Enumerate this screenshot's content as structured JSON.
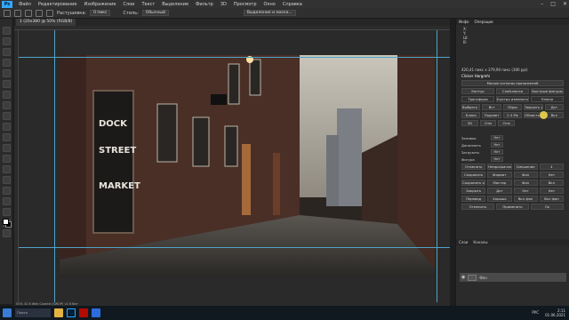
{
  "app": {
    "logo": "Ps"
  },
  "menu": [
    "Файл",
    "Редактирование",
    "Изображение",
    "Слои",
    "Текст",
    "Выделение",
    "Фильтр",
    "3D",
    "Просмотр",
    "Окно",
    "Справка"
  ],
  "options_bar": {
    "label1": "Растушевка:",
    "feather_value": "0 пикс",
    "label2": "Стиль:",
    "style_value": "Обычный",
    "label3": "Выделение и маска..."
  },
  "document_tab": "1 (20x380 @ 50% (RGB/8)",
  "status": "50%     32.6 Web Coated (SWOP) v2 8 бит",
  "panel": {
    "tabs": [
      "Инфо",
      "Операции"
    ],
    "info_lines": [
      "X:",
      "Y:",
      "Ш:",
      "В:"
    ],
    "doc_size": "420,41 пикс x 379,90 пикс (300 ppi)",
    "header": "Clicker Hargrehi",
    "section_title": "Малые сигналы приложений",
    "btns_row1": [
      "Контур",
      "Слой-маска",
      "Быстрые фигуры"
    ],
    "btns_row2": [
      "Трансформ",
      "Быстро изменить",
      "Ключи"
    ],
    "btns_row3": [
      "Выбрать точку...",
      "Вст",
      "Сброс",
      "Закрыть документ",
      "Дкт"
    ],
    "btns_row4": [
      "Блоки",
      "Подсвет",
      "2 4 Ms",
      "Область применения",
      "Вкл"
    ],
    "btns_row5": [
      "3D",
      "Отм",
      "Отм"
    ],
    "props": [
      {
        "k": "Заливка",
        "v": "Нет"
      },
      {
        "k": "Дополнить",
        "v": "Нет"
      },
      {
        "k": "Загрузить",
        "v": "Нет"
      },
      {
        "k": "Фигура",
        "v": "Нет"
      }
    ],
    "row_ops": [
      "Отменить",
      "Непрозрачность",
      "Смешение",
      "4"
    ],
    "grid_a": [
      "Сохранить",
      "Формат",
      "Фон",
      "Нет"
    ],
    "grid_b": [
      "Сохранить как...",
      "Мастер",
      "Фон",
      "Вкл"
    ],
    "grid_c": [
      "Закрыть",
      "Дкт",
      "Нет",
      "Нет"
    ],
    "grid_d": [
      "Перевод",
      "Хорошо",
      "Вкл фон",
      "Вкл фон"
    ],
    "foot": [
      "Отменить",
      "Применить",
      "Ок"
    ],
    "layers_tabs": [
      "Слои",
      "Каналы"
    ],
    "layer_name": "Фон"
  },
  "taskbar": {
    "search": "Поиск",
    "time": "2:11",
    "date": "01.06.2021",
    "lang": "РУС"
  },
  "colors": {
    "accent": "#31a8ff",
    "guide": "#4fa3c7",
    "highlight": "#f2d54a"
  }
}
